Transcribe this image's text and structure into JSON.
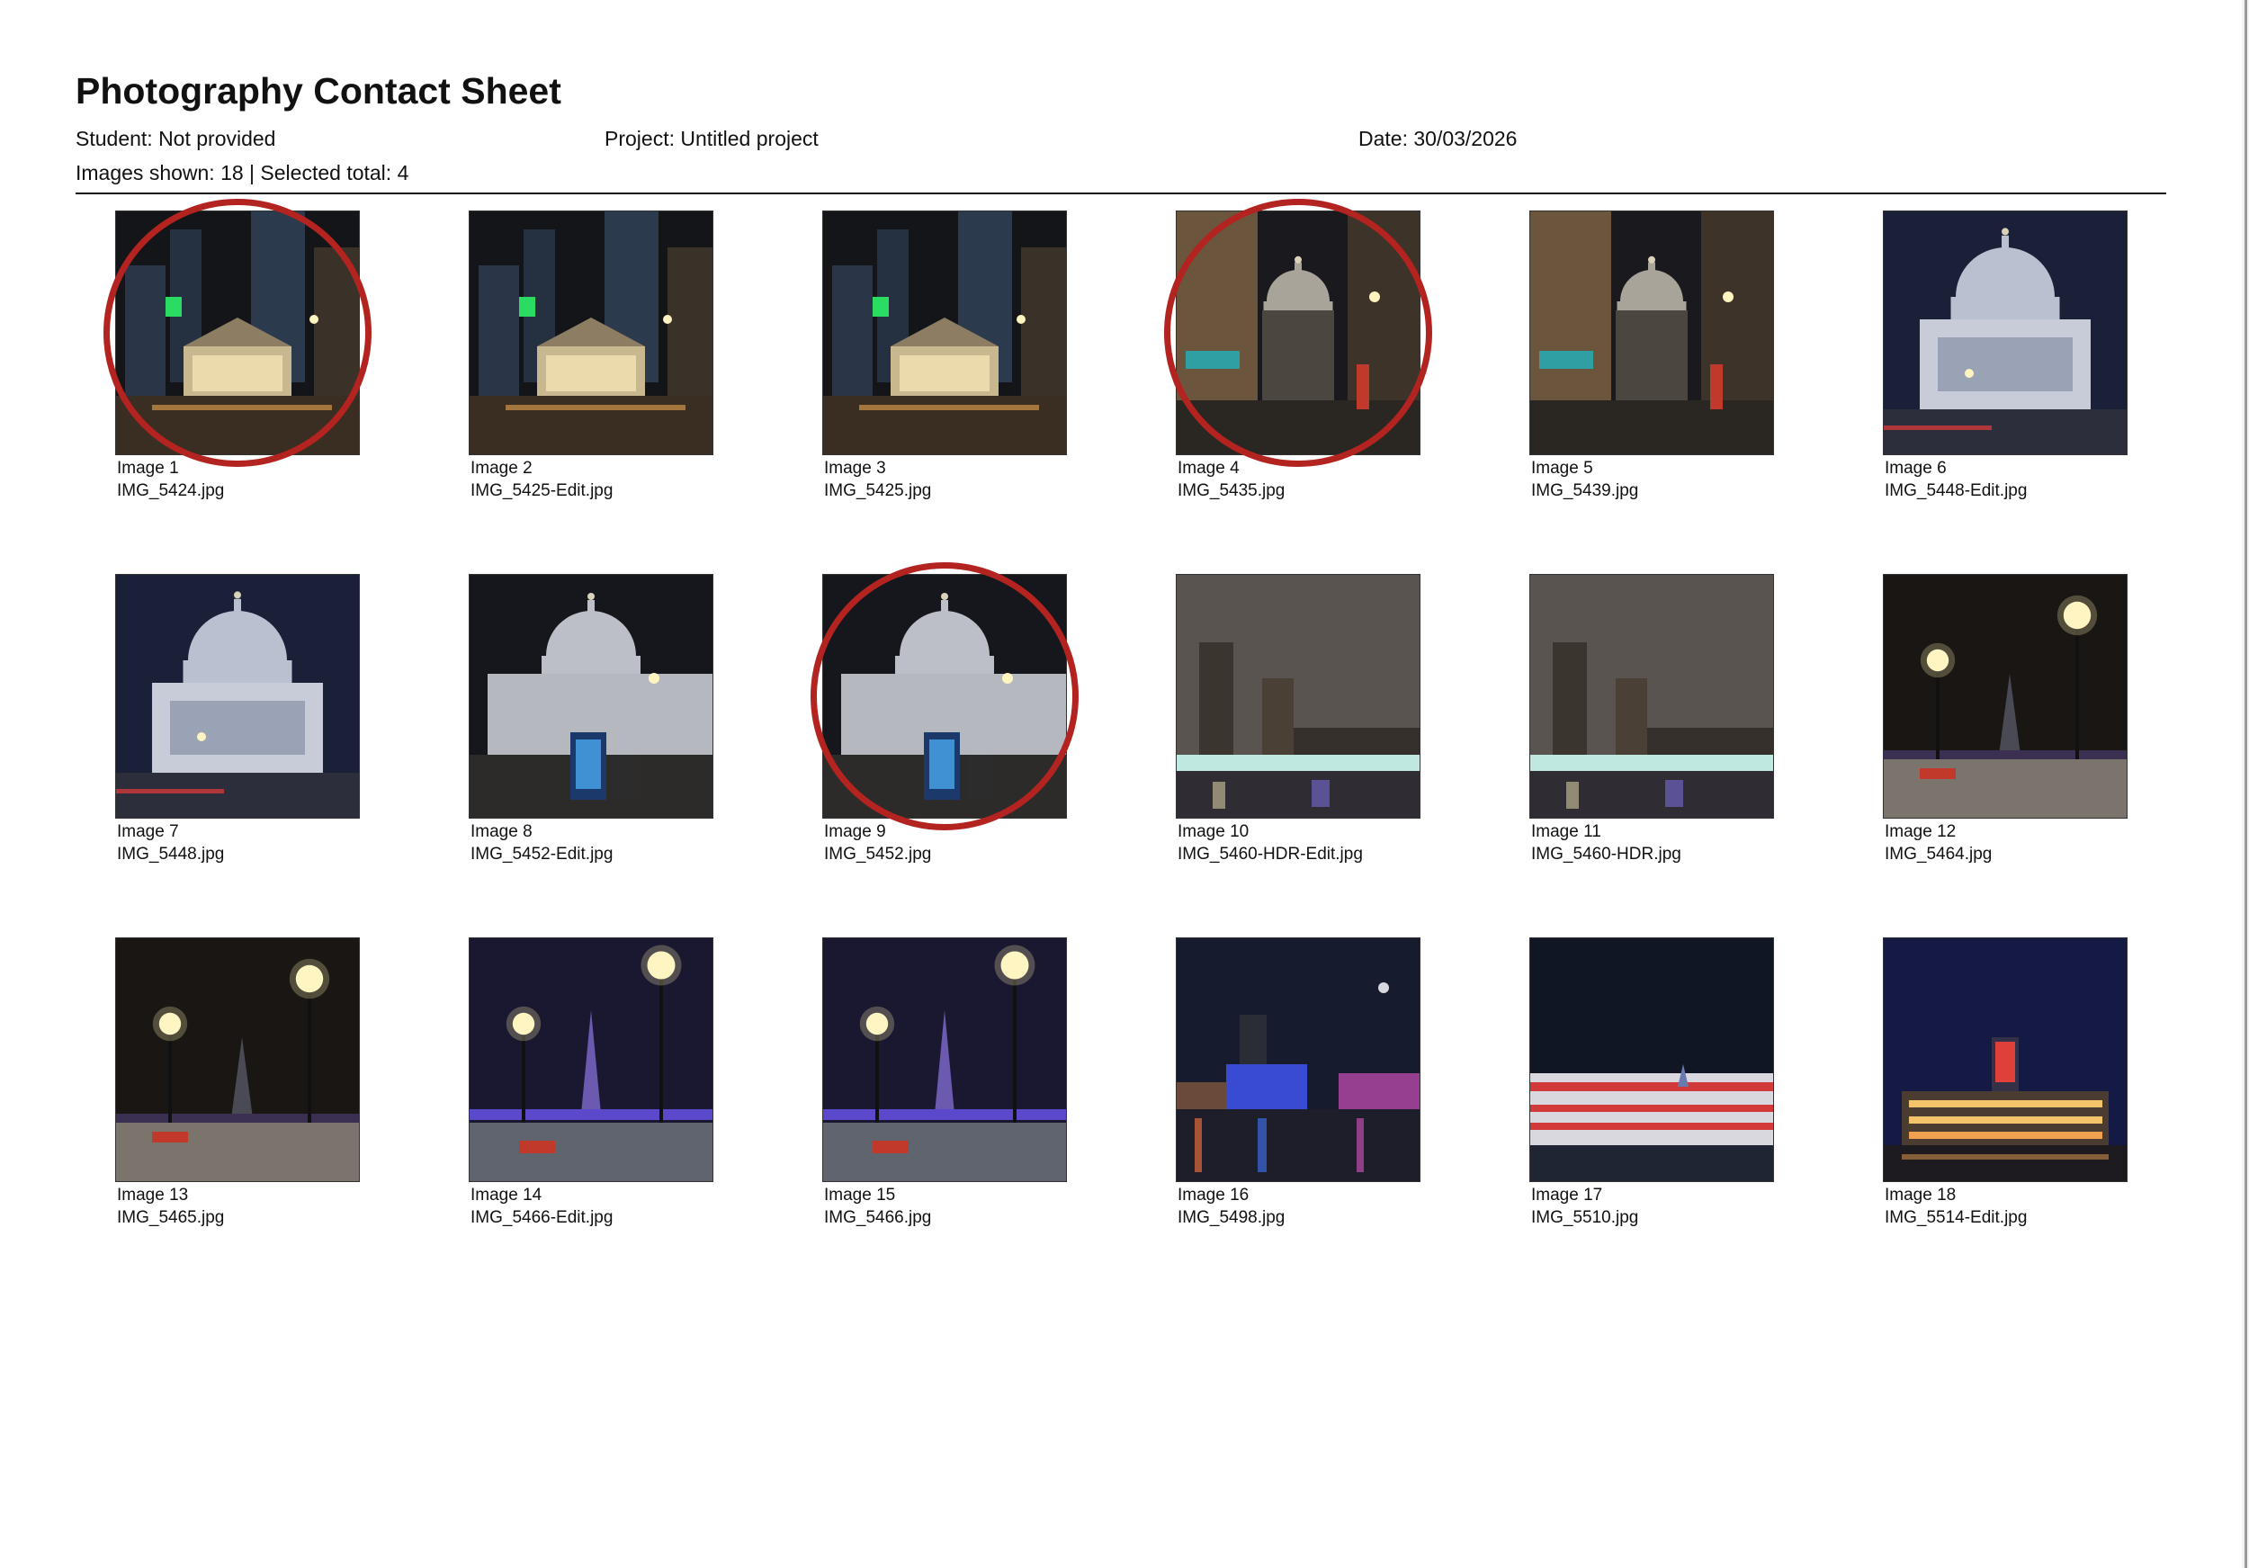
{
  "header": {
    "title": "Photography Contact Sheet",
    "student": "Student: Not provided",
    "project": "Project: Untitled project",
    "date": "Date: 30/03/2026",
    "counts": "Images shown: 18 | Selected total: 4"
  },
  "colors": {
    "selection_ring": "#b3231f",
    "rule": "#111111"
  },
  "images": [
    {
      "label": "Image 1",
      "file": "IMG_5424.jpg",
      "selected": true,
      "scene": "exchange-night"
    },
    {
      "label": "Image 2",
      "file": "IMG_5425-Edit.jpg",
      "selected": false,
      "scene": "exchange-night"
    },
    {
      "label": "Image 3",
      "file": "IMG_5425.jpg",
      "selected": false,
      "scene": "exchange-night"
    },
    {
      "label": "Image 4",
      "file": "IMG_5435.jpg",
      "selected": true,
      "scene": "alley-dome"
    },
    {
      "label": "Image 5",
      "file": "IMG_5439.jpg",
      "selected": false,
      "scene": "alley-dome"
    },
    {
      "label": "Image 6",
      "file": "IMG_5448-Edit.jpg",
      "selected": false,
      "scene": "cathedral"
    },
    {
      "label": "Image 7",
      "file": "IMG_5448.jpg",
      "selected": false,
      "scene": "cathedral"
    },
    {
      "label": "Image 8",
      "file": "IMG_5452-Edit.jpg",
      "selected": false,
      "scene": "cathedral-phonebox"
    },
    {
      "label": "Image 9",
      "file": "IMG_5452.jpg",
      "selected": true,
      "scene": "cathedral-phonebox"
    },
    {
      "label": "Image 10",
      "file": "IMG_5460-HDR-Edit.jpg",
      "selected": false,
      "scene": "river-towers"
    },
    {
      "label": "Image 11",
      "file": "IMG_5460-HDR.jpg",
      "selected": false,
      "scene": "river-towers"
    },
    {
      "label": "Image 12",
      "file": "IMG_5464.jpg",
      "selected": false,
      "scene": "lamps-shard"
    },
    {
      "label": "Image 13",
      "file": "IMG_5465.jpg",
      "selected": false,
      "scene": "lamps-shard"
    },
    {
      "label": "Image 14",
      "file": "IMG_5466-Edit.jpg",
      "selected": false,
      "scene": "lamps-shard-blue"
    },
    {
      "label": "Image 15",
      "file": "IMG_5466.jpg",
      "selected": false,
      "scene": "lamps-shard-blue"
    },
    {
      "label": "Image 16",
      "file": "IMG_5498.jpg",
      "selected": false,
      "scene": "river-lights"
    },
    {
      "label": "Image 17",
      "file": "IMG_5510.jpg",
      "selected": false,
      "scene": "bus-trails"
    },
    {
      "label": "Image 18",
      "file": "IMG_5514-Edit.jpg",
      "selected": false,
      "scene": "oxo-tower"
    }
  ]
}
